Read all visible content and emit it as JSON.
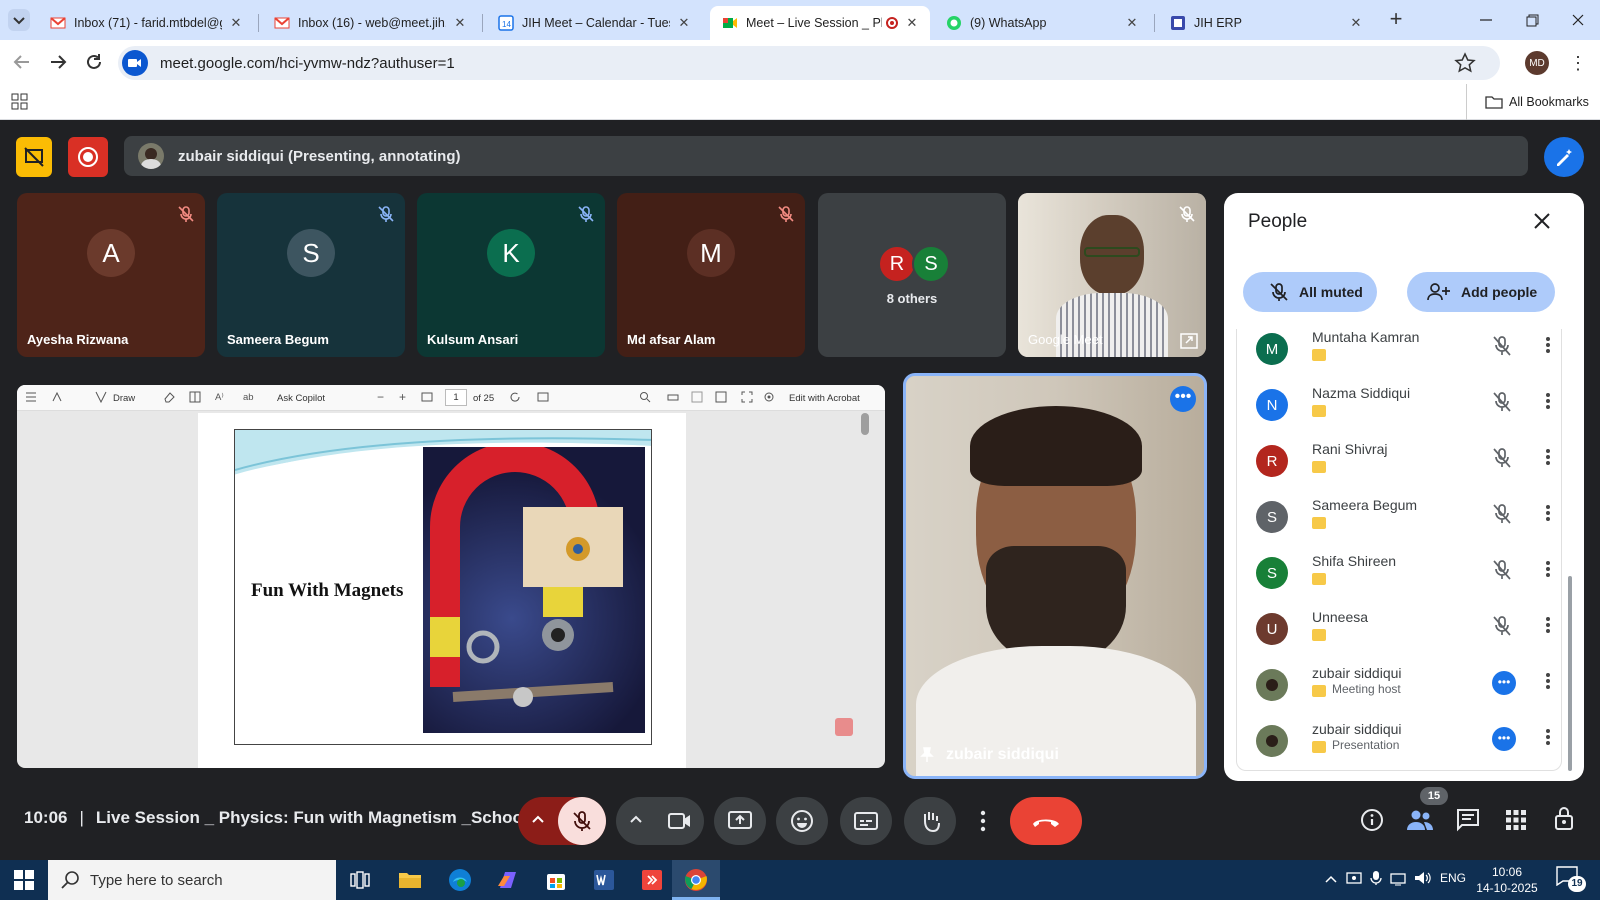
{
  "browser": {
    "tabs": [
      {
        "title": "Inbox (71) - farid.mtbdel@gm",
        "icon": "gmail-icon"
      },
      {
        "title": "Inbox (16) - web@meet.jih.o",
        "icon": "gmail-icon"
      },
      {
        "title": "JIH Meet – Calendar - Tuesd",
        "icon": "calendar-icon"
      },
      {
        "title": "Meet – Live Session _ Phy",
        "icon": "meet-icon"
      },
      {
        "title": "(9) WhatsApp",
        "icon": "whatsapp-icon"
      },
      {
        "title": "JIH ERP",
        "icon": "erp-icon"
      }
    ],
    "url": "meet.google.com/hci-yvmw-ndz?authuser=1",
    "profile_initials": "MD",
    "all_bookmarks": "All Bookmarks"
  },
  "meet": {
    "presenter_banner": "zubair siddiqui (Presenting, annotating)",
    "tiles": [
      {
        "initial": "A",
        "name": "Ayesha Rizwana",
        "color": "#5b2a1e"
      },
      {
        "initial": "S",
        "name": "Sameera Begum",
        "color": "#1b3a44"
      },
      {
        "initial": "K",
        "name": "Kulsum Ansari",
        "color": "#10403a"
      },
      {
        "initial": "M",
        "name": "Md afsar Alam",
        "color": "#4a2218"
      }
    ],
    "others": {
      "initials": [
        "R",
        "S"
      ],
      "label": "8 others"
    },
    "video_tile_label": "Google Meet",
    "pinned_name": "zubair siddiqui",
    "pdf": {
      "page": "1",
      "of_pages": "of 25",
      "draw": "Draw",
      "ask_copilot": "Ask Copilot",
      "edit_acrobat": "Edit with Acrobat",
      "slide_title": "Fun With Magnets"
    }
  },
  "people": {
    "title": "People",
    "all_muted": "All muted",
    "add_people": "Add people",
    "list": [
      {
        "initial": "M",
        "name": "Muntaha Kamran",
        "role": "",
        "color": "#0b6e4f"
      },
      {
        "initial": "N",
        "name": "Nazma Siddiqui",
        "role": "",
        "color": "#1a73e8"
      },
      {
        "initial": "R",
        "name": "Rani Shivraj",
        "role": "",
        "color": "#b3261e"
      },
      {
        "initial": "S",
        "name": "Sameera Begum",
        "role": "",
        "color": "#5f6368"
      },
      {
        "initial": "S",
        "name": "Shifa Shireen",
        "role": "",
        "color": "#188038"
      },
      {
        "initial": "U",
        "name": "Unneesa",
        "role": "",
        "color": "#6d3a2e"
      },
      {
        "initial": "",
        "name": "zubair siddiqui",
        "role": "Meeting host",
        "color": "#6b7a5a"
      },
      {
        "initial": "",
        "name": "zubair siddiqui",
        "role": "Presentation",
        "color": "#6b7a5a"
      }
    ]
  },
  "bottom": {
    "time": "10:06",
    "meeting_title": "Live Session _ Physics: Fun with Magnetism _School...",
    "participants_count": "15"
  },
  "taskbar": {
    "search_placeholder": "Type here to search",
    "lang": "ENG",
    "clock_time": "10:06",
    "clock_date": "14-10-2025",
    "notifications": "19"
  }
}
